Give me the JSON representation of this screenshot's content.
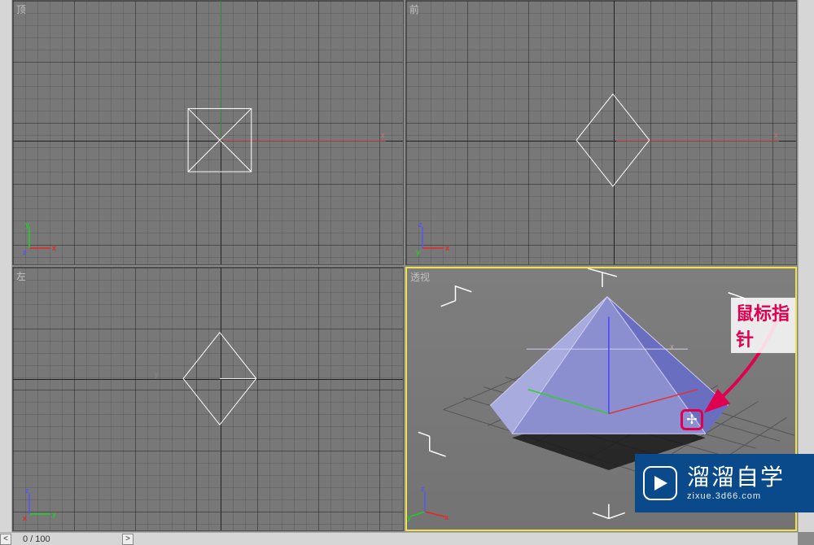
{
  "viewports": {
    "top": {
      "label": "顶"
    },
    "front": {
      "label": "前"
    },
    "left": {
      "label": "左"
    },
    "persp": {
      "label": "透视"
    }
  },
  "axis_labels": {
    "x": "x",
    "y": "y",
    "z": "z"
  },
  "annotation": {
    "label": "鼠标指针",
    "cursor_glyph": "✢"
  },
  "timebar": {
    "frame_display": "0 / 100",
    "scroll_left_glyph": "<",
    "scroll_right_glyph": ">"
  },
  "watermark": {
    "main": "溜溜自学",
    "sub": "zixue.3d66.com"
  },
  "colors": {
    "accent_active_viewport": "#f2e24a",
    "annotation": "#e00050",
    "watermark_bg": "#0a4a8b",
    "x_axis": "#e22222",
    "y_axis": "#22c022",
    "z_axis": "#4444ff"
  },
  "scene": {
    "object": "pyramid",
    "selected": true,
    "viewports": 4,
    "active_viewport": "perspective"
  }
}
